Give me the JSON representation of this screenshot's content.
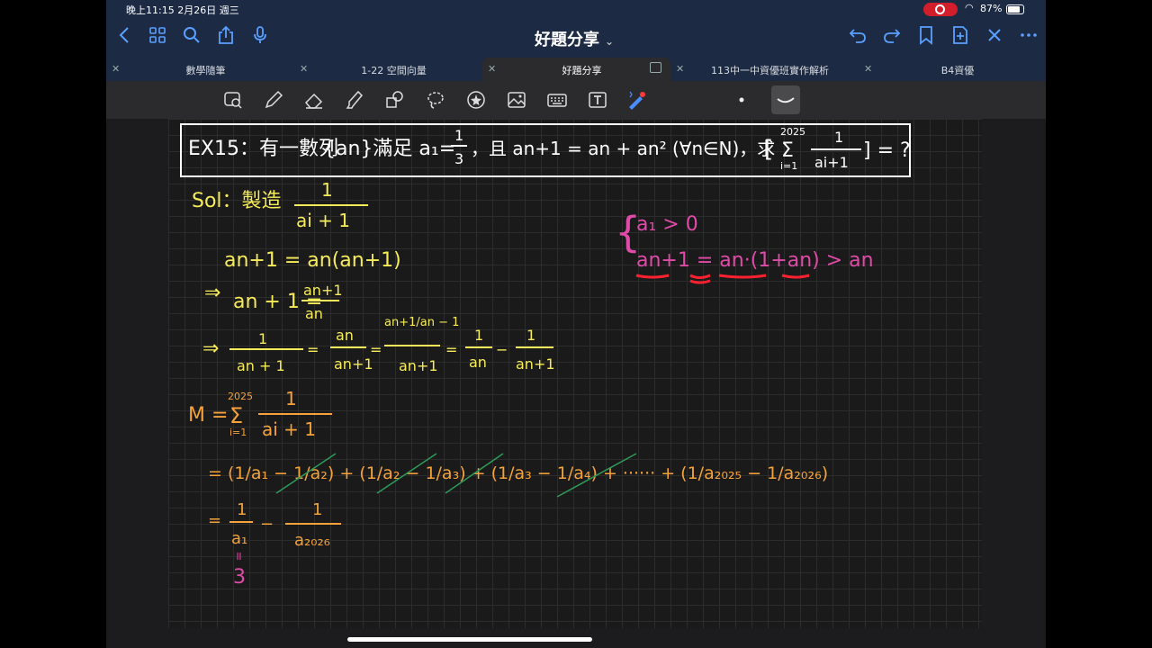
{
  "status": {
    "time": "晚上11:15   2月26日 週三",
    "battery": "87%"
  },
  "nav": {
    "title": "好題分享",
    "icons": [
      "back-icon",
      "grid-icon",
      "search-icon",
      "share-icon",
      "mic-icon",
      "undo-icon",
      "redo-icon",
      "bookmark-icon",
      "add-page-icon",
      "close-icon",
      "more-icon"
    ]
  },
  "tabs": [
    "數學隨筆",
    "1-22 空間向量",
    "好題分享",
    "113中一中資優班實作解析",
    "B4資優"
  ],
  "toolbar": {
    "tools": [
      "lasso-zoom",
      "pen",
      "eraser",
      "highlighter",
      "shapes",
      "lasso",
      "sticker",
      "image",
      "keyboard",
      "text",
      "laser",
      "dot-size",
      "stroke-smooth"
    ]
  },
  "note": {
    "problem": {
      "a": "EX15：有一數列",
      "b": "{an}滿足 a₁=",
      "c": "1",
      "d": "3",
      "e": "，且 an+1 = an + an²  (∀n∈N)，求",
      "sum_top": "2025",
      "sum_sym": "Σ",
      "sum_bot": "i=1",
      "frac_num": "1",
      "frac_den": "ai+1",
      "tail": "] = ?"
    },
    "sol": {
      "label": "Sol：製造",
      "num": "1",
      "den": "ai + 1"
    },
    "l2": "an+1 = an(an+1)",
    "l3": {
      "arrow": "⇒",
      "lhs": "an + 1 =",
      "num": "an+1",
      "den": "an"
    },
    "l4": {
      "arrow": "⇒",
      "f1n": "1",
      "f1d": "an + 1",
      "eq1": "=",
      "f2n": "an",
      "f2d": "an+1",
      "eq2": "=",
      "f3n": "an+1/an − 1",
      "f3d": "an+1",
      "eq3": "=",
      "f4n": "1",
      "f4d": "an",
      "minus": "−",
      "f5n": "1",
      "f5d": "an+1"
    },
    "m": {
      "lhs": "M =",
      "top": "2025",
      "sym": "Σ",
      "bot": "i=1",
      "num": "1",
      "den": "ai + 1"
    },
    "tel": "= (1/a₁ − 1/a₂) + (1/a₂ − 1/a₃) + (1/a₃ − 1/a₄) + ······ + (1/a₂₀₂₅ − 1/a₂₀₂₆)",
    "res": {
      "eq": "=",
      "n1": "1",
      "d1": "a₁",
      "minus": "−",
      "n2": "1",
      "d2": "a₂₀₂₆",
      "eqmark": "॥",
      "val": "3"
    },
    "side": {
      "brace": "{",
      "l1": "a₁ > 0",
      "l2": "an+1 = an·(1+an) > an"
    }
  }
}
